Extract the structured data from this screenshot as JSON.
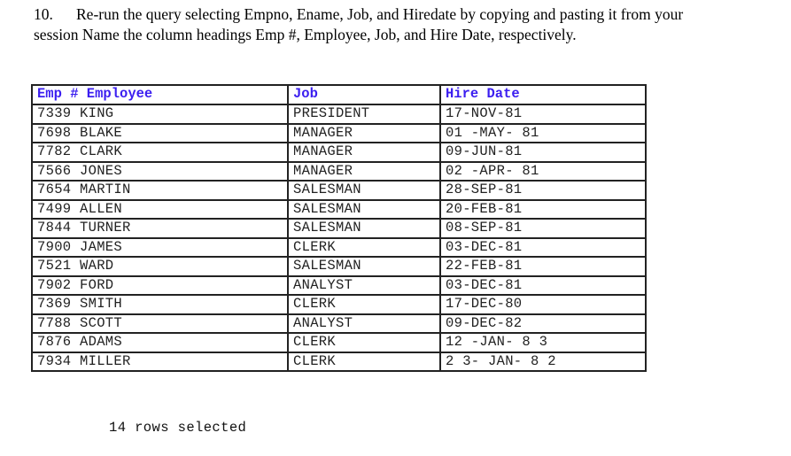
{
  "instruction": {
    "number": "10.",
    "line1": "Re-run the query selecting Empno, Ename, Job, and Hiredate by copying and pasting it from your",
    "line2": "session Name the column headings Emp #, Employee, Job, and Hire Date, respectively."
  },
  "table": {
    "headers": [
      "Emp # Employee",
      "Job",
      "Hire Date"
    ],
    "header_color": "#3b1ef0",
    "rows": [
      {
        "emp": "7339 KING",
        "job": "PRESIDENT",
        "hire_date": "17-NOV-81"
      },
      {
        "emp": "7698 BLAKE",
        "job": "MANAGER",
        "hire_date": "01 -MAY- 81"
      },
      {
        "emp": "7782 CLARK",
        "job": "MANAGER",
        "hire_date": "09-JUN-81"
      },
      {
        "emp": "7566 JONES",
        "job": "MANAGER",
        "hire_date": "02 -APR- 81"
      },
      {
        "emp": "7654 MARTIN",
        "job": "SALESMAN",
        "hire_date": "28-SEP-81"
      },
      {
        "emp": "7499 ALLEN",
        "job": "SALESMAN",
        "hire_date": "20-FEB-81"
      },
      {
        "emp": "7844 TURNER",
        "job": "SALESMAN",
        "hire_date": "08-SEP-81"
      },
      {
        "emp": "7900 JAMES",
        "job": "CLERK",
        "hire_date": "03-DEC-81"
      },
      {
        "emp": "7521 WARD",
        "job": "SALESMAN",
        "hire_date": "22-FEB-81"
      },
      {
        "emp": "7902 FORD",
        "job": "ANALYST",
        "hire_date": "03-DEC-81"
      },
      {
        "emp": "7369 SMITH",
        "job": "CLERK",
        "hire_date": "17-DEC-80"
      },
      {
        "emp": "7788 SCOTT",
        "job": "ANALYST",
        "hire_date": "09-DEC-82"
      },
      {
        "emp": "7876 ADAMS",
        "job": "CLERK",
        "hire_date": "12 -JAN- 8 3"
      },
      {
        "emp": "7934 MILLER",
        "job": "CLERK",
        "hire_date": "2 3- JAN- 8 2"
      }
    ]
  },
  "footer": {
    "rows_selected": "14 rows selected"
  }
}
